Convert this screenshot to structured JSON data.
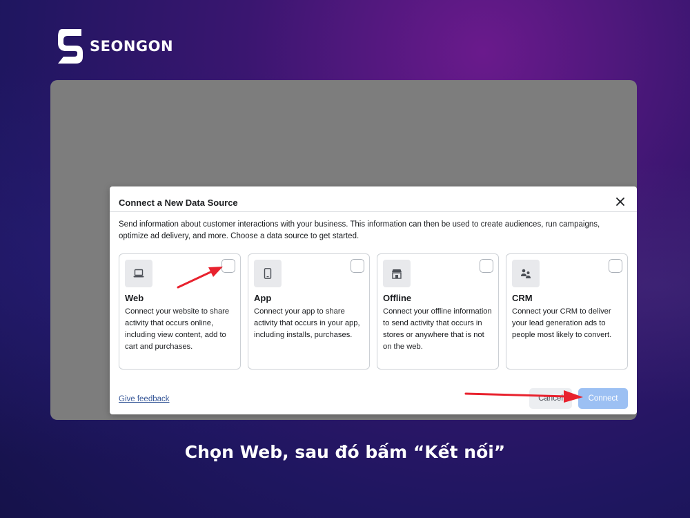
{
  "brand": {
    "name": "SEONGON"
  },
  "dialog": {
    "title": "Connect a New Data Source",
    "description": "Send information about customer interactions with your business. This information can then be used to create audiences, run campaigns, optimize ad delivery, and more. Choose a data source to get started.",
    "cards": [
      {
        "name": "Web",
        "icon": "laptop-icon",
        "description": "Connect your website to share activity that occurs online, including view content, add to cart and purchases."
      },
      {
        "name": "App",
        "icon": "phone-icon",
        "description": "Connect your app to share activity that occurs in your app, including installs, purchases."
      },
      {
        "name": "Offline",
        "icon": "store-icon",
        "description": "Connect your offline information to send activity that occurs in stores or anywhere that is not on the web."
      },
      {
        "name": "CRM",
        "icon": "people-icon",
        "description": "Connect your CRM to deliver your lead generation ads to people most likely to convert."
      }
    ],
    "feedback_link": "Give feedback",
    "cancel_label": "Cancel",
    "connect_label": "Connect"
  },
  "caption": "Chọn Web, sau đó bấm “Kết nối”",
  "colors": {
    "background": "#2a1668",
    "annotation_arrow": "#e8222e",
    "connect_button": "#9cc0f3",
    "link": "#385898"
  }
}
